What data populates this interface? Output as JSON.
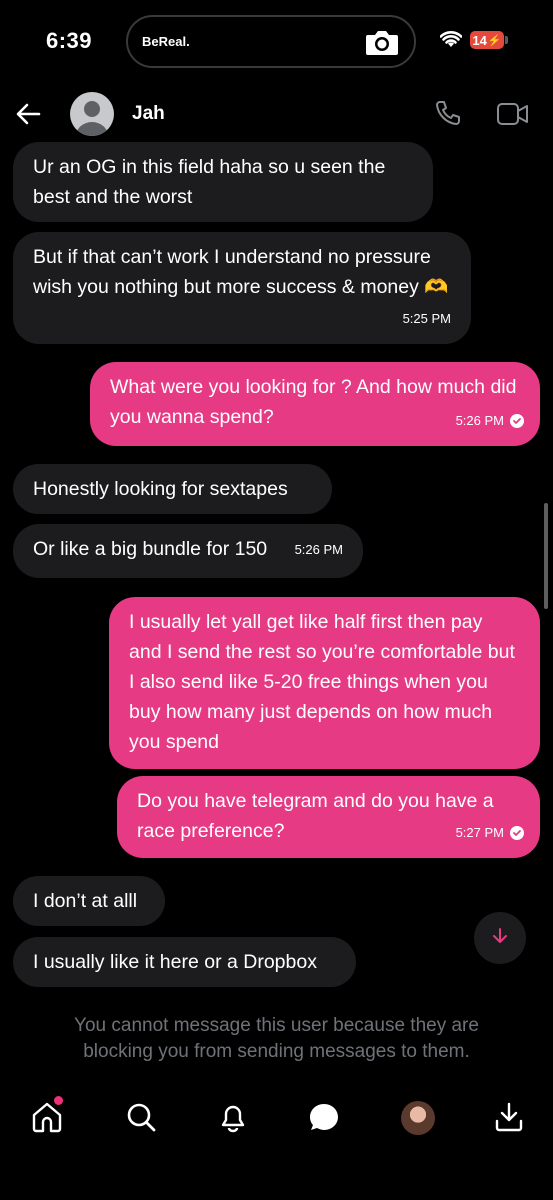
{
  "status_bar": {
    "time": "6:39",
    "island_app": "BeReal.",
    "battery": "14"
  },
  "header": {
    "contact_name": "Jah"
  },
  "messages": [
    {
      "dir": "in",
      "text": "Ur an OG in this field haha so u seen the best and the worst",
      "time": ""
    },
    {
      "dir": "in",
      "text": "But if that can’t work I understand no pressure wish you nothing but more success & money 🫶",
      "time": "5:25 PM"
    },
    {
      "dir": "out",
      "text": "What were you looking for ? And how much did you wanna spend?",
      "time": "5:26 PM"
    },
    {
      "dir": "in",
      "text": "Honestly looking for sextapes",
      "time": ""
    },
    {
      "dir": "in",
      "text": "Or like a big bundle for 150",
      "time": "5:26 PM"
    },
    {
      "dir": "out",
      "text": "I usually let yall get like half first then pay and I send the rest so you’re comfortable but I also send like 5-20 free things when you buy how many just depends on how much you spend",
      "time": ""
    },
    {
      "dir": "out",
      "text": "Do you have telegram and do you have a race preference?",
      "time": "5:27 PM"
    },
    {
      "dir": "in",
      "text": "I don’t at alll",
      "time": ""
    },
    {
      "dir": "in",
      "text": "I usually like it here or a Dropbox",
      "time": ""
    }
  ],
  "blocked_notice": "You cannot message this user because they are blocking you from sending messages to them.",
  "colors": {
    "outgoing_bubble": "#e63a84",
    "incoming_bubble": "#1c1c1e",
    "background": "#000000",
    "muted_text": "#6f7378",
    "notification_dot": "#f0307a"
  },
  "nav": [
    "home-icon",
    "search-icon",
    "bell-icon",
    "messages-icon",
    "profile-avatar",
    "download-icon"
  ]
}
